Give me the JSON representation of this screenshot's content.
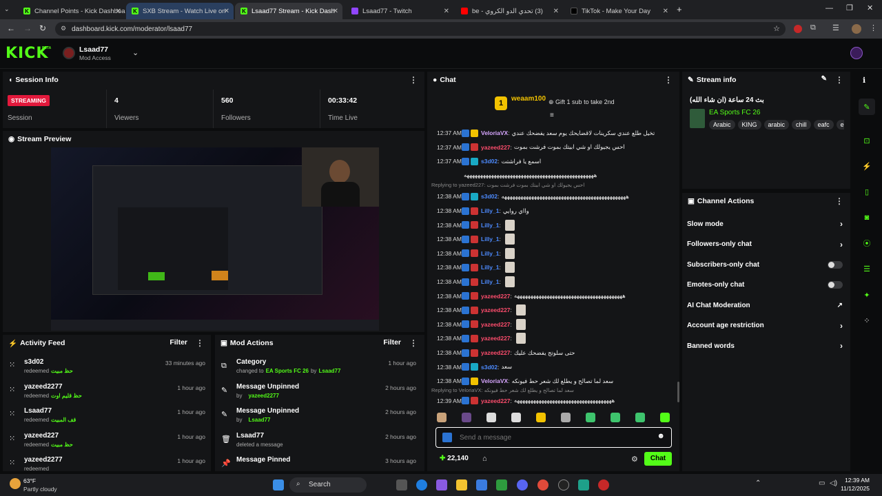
{
  "browser": {
    "tabs": [
      "Channel Points - Kick Dashboa",
      "SXB Stream - Watch Live on",
      "Lsaad77 Stream - Kick Dash",
      "Lsaad77 - Twitch",
      "be - ‫(3) تحدي الدو الكروي",
      "TikTok - Make Your Day"
    ],
    "url": "dashboard.kick.com/moderator/lsaad77"
  },
  "header": {
    "logo": "KICK",
    "beta": "BETA",
    "channel": "Lsaad77",
    "role": "Mod Access"
  },
  "session": {
    "title": "Session Info",
    "status": "STREAMING",
    "status_label": "Session",
    "viewers": "4",
    "viewers_label": "Viewers",
    "followers": "560",
    "followers_label": "Followers",
    "time": "00:33:42",
    "time_label": "Time Live"
  },
  "preview": {
    "title": "Stream Preview"
  },
  "activity": {
    "title": "Activity Feed",
    "filter": "Filter",
    "items": [
      {
        "name": "s3d02",
        "text": "redeemed",
        "reward": "حظ مبيت",
        "time": "33 minutes ago"
      },
      {
        "name": "yazeed2277",
        "text": "redeemed",
        "reward": "حظ قليم اوت",
        "time": "1 hour ago"
      },
      {
        "name": "Lsaad77",
        "text": "redeemed",
        "reward": "قف المبيت",
        "time": "1 hour ago"
      },
      {
        "name": "yazeed227",
        "text": "redeemed",
        "reward": "حظ مبيت",
        "time": "1 hour ago"
      },
      {
        "name": "yazeed2277",
        "text": "redeemed",
        "reward": "",
        "time": "1 hour ago"
      }
    ]
  },
  "modactions": {
    "title": "Mod Actions",
    "filter": "Filter",
    "items": [
      {
        "title": "Category",
        "sub1": "changed to",
        "hl": "EA Sports FC 26",
        "sub2": "by",
        "user": "Lsaad77",
        "time": "1 hour ago"
      },
      {
        "title": "Message Unpinned",
        "sub1": "by",
        "hl": "",
        "sub2": "",
        "user": "yazeed2277",
        "time": "2 hours ago"
      },
      {
        "title": "Message Unpinned",
        "sub1": "by",
        "hl": "",
        "sub2": "",
        "user": "Lsaad77",
        "time": "2 hours ago"
      },
      {
        "title": "Lsaad77",
        "sub1": "deleted a message",
        "hl": "",
        "sub2": "",
        "user": "",
        "time": "2 hours ago"
      },
      {
        "title": "Message Pinned",
        "sub1": "",
        "hl": "",
        "sub2": "",
        "user": "",
        "time": "3 hours ago"
      }
    ]
  },
  "chat": {
    "title": "Chat",
    "gifter": "weaam100",
    "gifter_count": "1",
    "gift_text": "Gift 1 sub to take 2nd",
    "placeholder": "Send a message",
    "points": "22,140",
    "send": "Chat",
    "replying1": "Replying to yazeed227:",
    "reply1_text": "احس يجيولك او شي ابيتك بموت فرشت بموت",
    "replying2": "Replying to VeloriaVX:",
    "reply2_text": "سعد لما تصالح و يطلع لك شعر حط فيونكه",
    "messages": [
      {
        "t": "12:37 AM",
        "u": "VeloriaVX",
        "c": "#d7a6ff",
        "m": "تخيل طلع عندي سكرينات لاقضايحك يوم سعد يفضحك عندي"
      },
      {
        "t": "12:37 AM",
        "u": "yazeed227",
        "c": "#ff4d6d",
        "m": "احس يجيولك او شي ابيتك بموت فرشت بموت"
      },
      {
        "t": "12:37 AM",
        "u": "s3d02",
        "c": "#4d8bff",
        "m": "اسمع يا فراشتت"
      },
      {
        "t": "",
        "u": "",
        "c": "#fff",
        "m": "ههههههههههههههههههههههههههههههههههههههههههههههههه"
      },
      {
        "t": "12:38 AM",
        "u": "s3d02",
        "c": "#4d8bff",
        "m": "ههههههههههههههههههههههههههههههههههههههههههههههه"
      },
      {
        "t": "12:38 AM",
        "u": "Lilly_1",
        "c": "#4d8bff",
        "m": "وااي روايي"
      },
      {
        "t": "12:38 AM",
        "u": "Lilly_1",
        "c": "#4d8bff",
        "m": ""
      },
      {
        "t": "12:38 AM",
        "u": "Lilly_1",
        "c": "#4d8bff",
        "m": ""
      },
      {
        "t": "12:38 AM",
        "u": "Lilly_1",
        "c": "#4d8bff",
        "m": ""
      },
      {
        "t": "12:38 AM",
        "u": "Lilly_1",
        "c": "#4d8bff",
        "m": ""
      },
      {
        "t": "12:38 AM",
        "u": "Lilly_1",
        "c": "#4d8bff",
        "m": ""
      },
      {
        "t": "12:38 AM",
        "u": "yazeed227",
        "c": "#ff4d6d",
        "m": "ههههههههههههههههههههههههههههههههههههههههه"
      },
      {
        "t": "12:38 AM",
        "u": "yazeed227",
        "c": "#ff4d6d",
        "m": ""
      },
      {
        "t": "12:38 AM",
        "u": "yazeed227",
        "c": "#ff4d6d",
        "m": ""
      },
      {
        "t": "12:38 AM",
        "u": "yazeed227",
        "c": "#ff4d6d",
        "m": ""
      },
      {
        "t": "12:38 AM",
        "u": "yazeed227",
        "c": "#ff4d6d",
        "m": "حتى سلوتج يفضحك عليك"
      },
      {
        "t": "12:38 AM",
        "u": "s3d02",
        "c": "#4d8bff",
        "m": "سعد"
      },
      {
        "t": "12:38 AM",
        "u": "VeloriaVX",
        "c": "#d7a6ff",
        "m": "سعد لما تصالح و يطلع لك شعر حط فيونكه"
      },
      {
        "t": "12:39 AM",
        "u": "yazeed227",
        "c": "#ff4d6d",
        "m": "ههههههههههههههههههههههههههههههههههههه"
      }
    ]
  },
  "streaminfo": {
    "title": "Stream info",
    "stream_title": "بث 24 ساعة (ان شاء الله)",
    "category": "EA Sports FC 26",
    "tags": [
      "Arabic",
      "KING",
      "arabic",
      "chill",
      "eafc",
      "ea"
    ]
  },
  "channelactions": {
    "title": "Channel Actions",
    "items": [
      {
        "label": "Slow mode",
        "kind": "chevron"
      },
      {
        "label": "Followers-only chat",
        "kind": "chevron"
      },
      {
        "label": "Subscribers-only chat",
        "kind": "toggle"
      },
      {
        "label": "Emotes-only chat",
        "kind": "toggle"
      },
      {
        "label": "AI Chat Moderation",
        "kind": "external"
      },
      {
        "label": "Account age restriction",
        "kind": "chevron"
      },
      {
        "label": "Banned words",
        "kind": "chevron"
      }
    ]
  },
  "taskbar": {
    "weather_temp": "63°F",
    "weather_text": "Partly cloudy",
    "search": "Search",
    "time": "12:39 AM",
    "date": "11/12/2025"
  }
}
